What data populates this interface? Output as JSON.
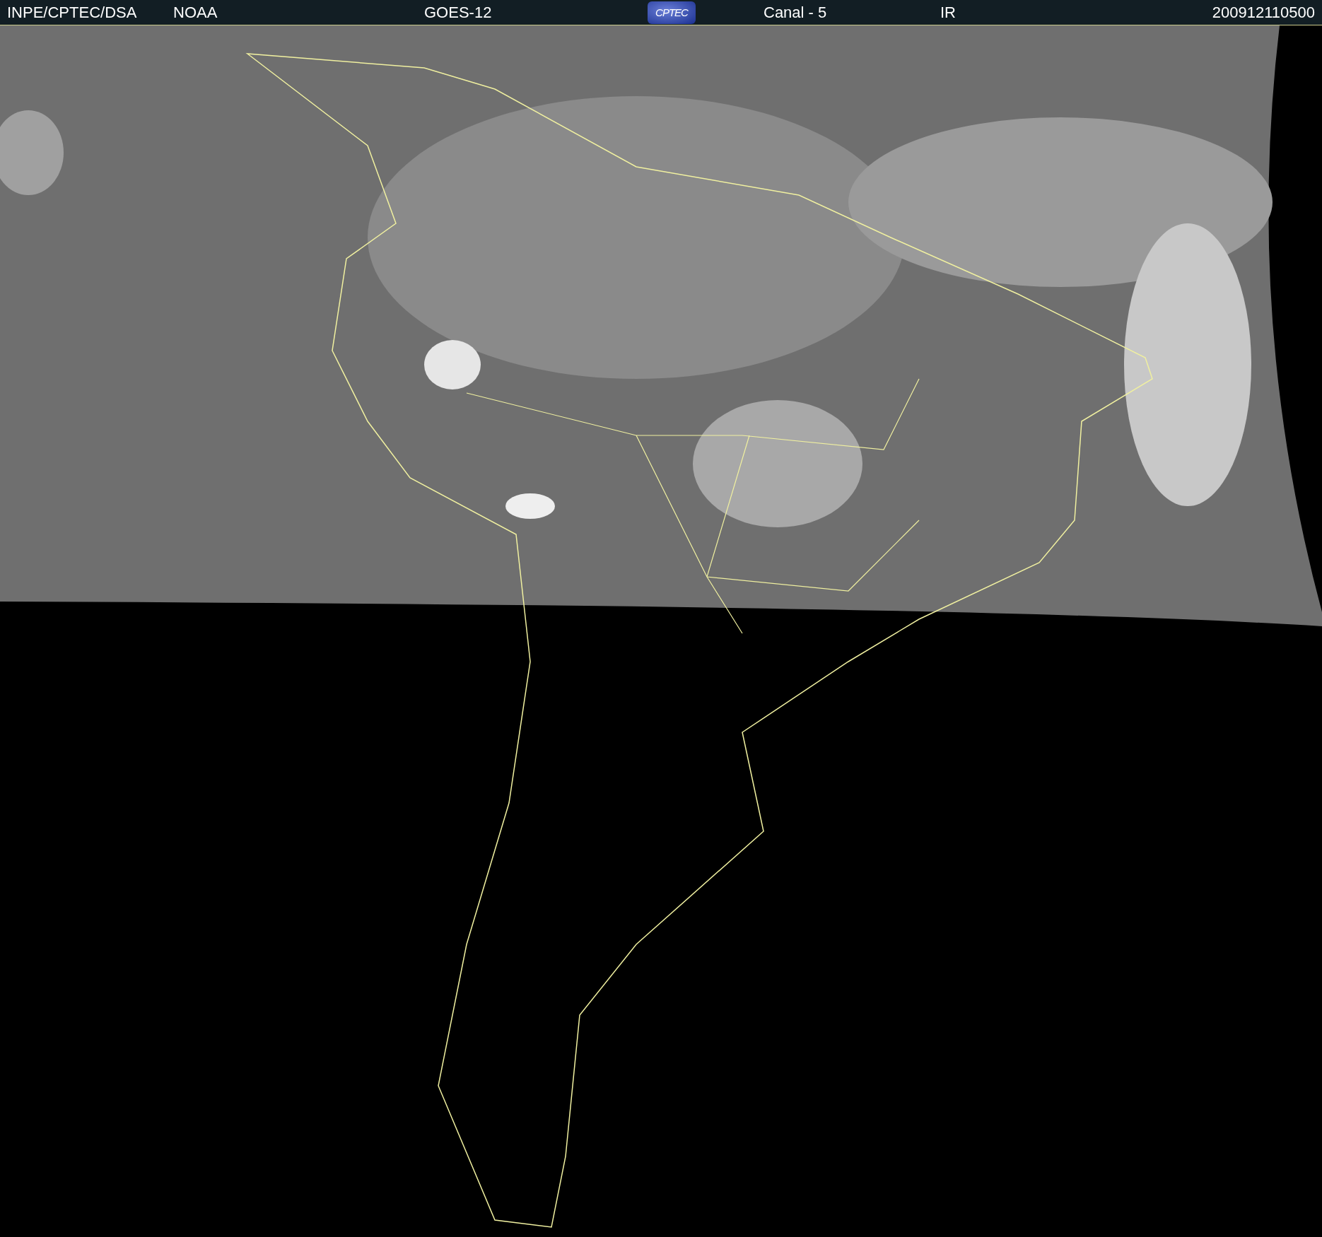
{
  "header": {
    "source": "INPE/CPTEC/DSA",
    "agency": "NOAA",
    "satellite": "GOES-12",
    "logo": "CPTEC",
    "channel": "Canal - 5",
    "band": "IR",
    "timestamp": "200912110500"
  }
}
